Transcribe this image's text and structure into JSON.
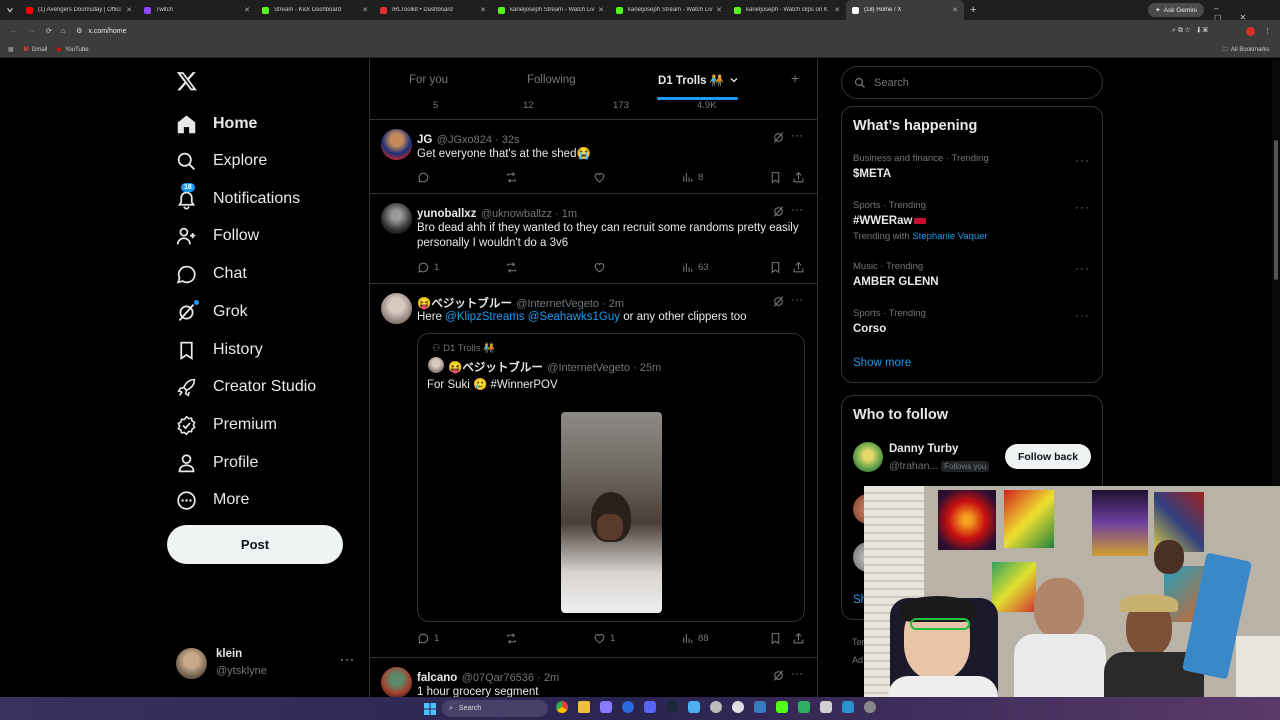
{
  "browser": {
    "tabs": [
      {
        "title": "(1) Avengers Doomsday | Offici",
        "color": "#ff0000"
      },
      {
        "title": "Twitch",
        "color": "#9146ff"
      },
      {
        "title": "Stream - Kick Dashboard",
        "color": "#53fc18"
      },
      {
        "title": "IRLToolkit • Dashboard",
        "color": "#e03030"
      },
      {
        "title": "kaneljoseph Stream - Watch Liv",
        "color": "#53fc18"
      },
      {
        "title": "kaneljoseph Stream - Watch Liv",
        "color": "#53fc18"
      },
      {
        "title": "kaneljoseph - Watch clips on K",
        "color": "#53fc18"
      },
      {
        "title": "(18) Home / X",
        "color": "#ffffff"
      }
    ],
    "ask_gemini": "Ask Gemini",
    "url": "x.com/home",
    "bookmarks": [
      "Gmail",
      "YouTube"
    ],
    "all_bookmarks": "All Bookmarks"
  },
  "nav": {
    "items": [
      {
        "label": "Home",
        "icon": "home-icon"
      },
      {
        "label": "Explore",
        "icon": "search-icon"
      },
      {
        "label": "Notifications",
        "icon": "bell-icon"
      },
      {
        "label": "Follow",
        "icon": "person-plus-icon"
      },
      {
        "label": "Chat",
        "icon": "chat-icon"
      },
      {
        "label": "Grok",
        "icon": "grok-icon"
      },
      {
        "label": "History",
        "icon": "bookmark-icon"
      },
      {
        "label": "Creator Studio",
        "icon": "rocket-icon"
      },
      {
        "label": "Premium",
        "icon": "verified-icon"
      },
      {
        "label": "Profile",
        "icon": "person-icon"
      },
      {
        "label": "More",
        "icon": "more-circle-icon"
      }
    ],
    "notif_badge": "18",
    "post_label": "Post",
    "account": {
      "name": "klein",
      "handle": "@ytsklyne"
    }
  },
  "feed": {
    "tabs": [
      "For you",
      "Following",
      "D1 Trolls 🧑‍🤝‍🧑"
    ],
    "partial_stats": {
      "replies": "5",
      "reposts": "12",
      "likes": "173",
      "views": "4.9K"
    },
    "tweets": [
      {
        "name": "JG",
        "handle": "@JGxo824",
        "time": "32s",
        "text": "Get everyone that's at the shed😭",
        "replies": "",
        "reposts": "",
        "likes": "",
        "views": "8"
      },
      {
        "name": "yunoballxz",
        "handle": "@uknowballzz",
        "time": "1m",
        "text": "Bro dead ahh if they wanted to they can recruit some randoms pretty easily personally I wouldn't do a 3v6",
        "replies": "1",
        "reposts": "",
        "likes": "",
        "views": "63"
      },
      {
        "name": "😝ベジットブルー",
        "handle": "@InternetVegeto",
        "time": "2m",
        "text_pre": "Here",
        "mention1": "@KlipzStreams",
        "mention2": "@Seahawks1Guy",
        "text_post": "or any other clippers too",
        "replies": "1",
        "reposts": "",
        "likes": "1",
        "views": "88",
        "quote": {
          "community": "D1 Trolls 🧑‍🤝‍🧑",
          "name": "😝ベジットブルー",
          "handle": "@InternetVegeto",
          "time": "25m",
          "text": "For Suki 🥲 #WinnerPOV"
        }
      },
      {
        "name": "falcano",
        "handle": "@07Qar76536",
        "time": "2m",
        "text": "1 hour grocery segment"
      }
    ]
  },
  "right": {
    "search_placeholder": "Search",
    "whats_happening": "What’s happening",
    "trends": [
      {
        "category": "Business and finance · Trending",
        "name": "$META"
      },
      {
        "category": "Sports · Trending",
        "name": "#WWERaw",
        "trending_with_label": "Trending with",
        "trending_with": "Stephanie Vaquer"
      },
      {
        "category": "Music · Trending",
        "name": "AMBER GLENN"
      },
      {
        "category": "Sports · Trending",
        "name": "Corso"
      }
    ],
    "show_more": "Show more",
    "who_to_follow": "Who to follow",
    "suggestion": {
      "name": "Danny Turby",
      "handle": "@trahan...",
      "follows_you": "Follows you",
      "button": "Follow back"
    },
    "footer_partial": [
      "Ter",
      "Ad"
    ],
    "show_partial": "Sh"
  },
  "taskbar": {
    "search": "Search"
  },
  "colors": {
    "accent": "#1d9bf0",
    "bg": "#000000",
    "border": "#2f3336",
    "muted": "#71767b"
  }
}
